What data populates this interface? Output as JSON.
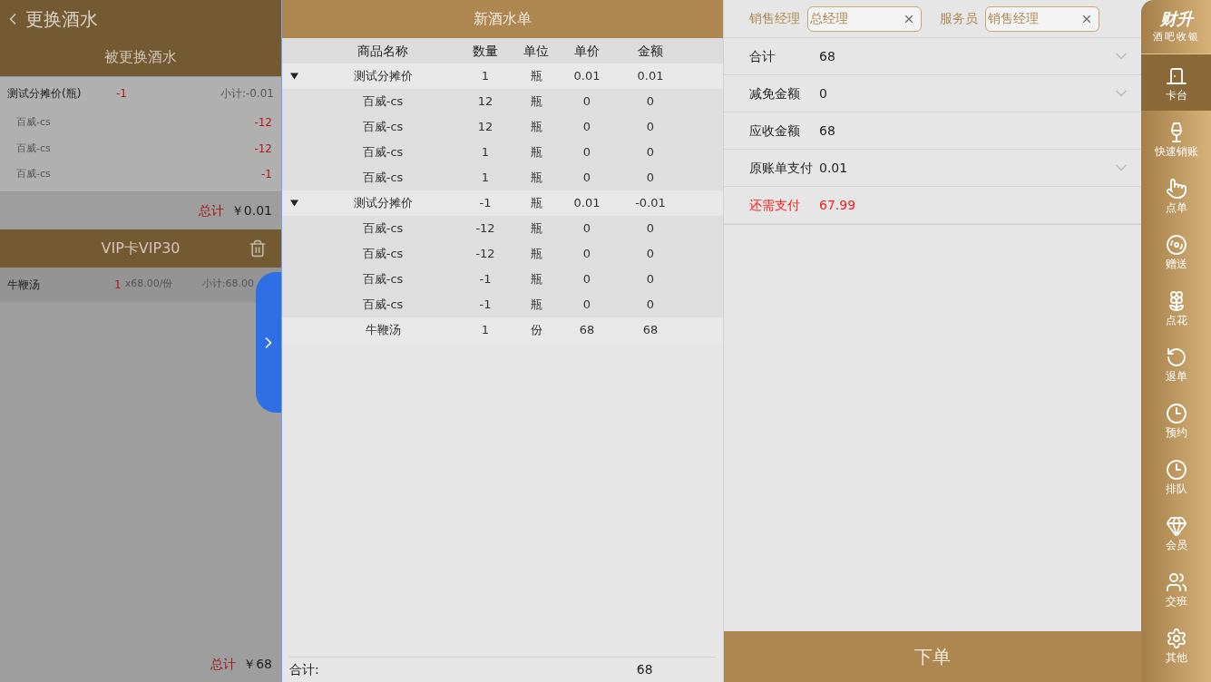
{
  "left_panel": {
    "back_title": "更换酒水",
    "replaced_header": "被更换酒水",
    "replaced_item": {
      "name": "测试分摊价(瓶)",
      "qty": "-1",
      "subtotal": "小计:-0.01",
      "children": [
        {
          "name": "百威-cs",
          "qty": "-12"
        },
        {
          "name": "百威-cs",
          "qty": "-12"
        },
        {
          "name": "百威-cs",
          "qty": "-1"
        }
      ]
    },
    "replaced_total": {
      "label": "总计",
      "value": "￥0.01"
    },
    "card_header": "VIP卡VIP30",
    "card_items": [
      {
        "name": "牛鞭汤",
        "qty": "1",
        "price": "x68.00/份",
        "subtotal": "小计:68.00"
      }
    ],
    "card_total": {
      "label": "总计",
      "value": "￥68"
    }
  },
  "new_order": {
    "title": "新酒水单",
    "columns": [
      "商品名称",
      "数量",
      "单位",
      "单价",
      "金额"
    ],
    "rows": [
      {
        "cells": [
          "测试分摊价",
          "1",
          "瓶",
          "0.01",
          "0.01"
        ],
        "expanded": true,
        "children": [
          {
            "cells": [
              "百威-cs",
              "12",
              "瓶",
              "0",
              "0"
            ]
          },
          {
            "cells": [
              "百威-cs",
              "12",
              "瓶",
              "0",
              "0"
            ]
          },
          {
            "cells": [
              "百威-cs",
              "1",
              "瓶",
              "0",
              "0"
            ]
          },
          {
            "cells": [
              "百威-cs",
              "1",
              "瓶",
              "0",
              "0"
            ]
          }
        ]
      },
      {
        "cells": [
          "测试分摊价",
          "-1",
          "瓶",
          "0.01",
          "-0.01"
        ],
        "expanded": true,
        "children": [
          {
            "cells": [
              "百威-cs",
              "-12",
              "瓶",
              "0",
              "0"
            ]
          },
          {
            "cells": [
              "百威-cs",
              "-12",
              "瓶",
              "0",
              "0"
            ]
          },
          {
            "cells": [
              "百威-cs",
              "-1",
              "瓶",
              "0",
              "0"
            ]
          },
          {
            "cells": [
              "百威-cs",
              "-1",
              "瓶",
              "0",
              "0"
            ]
          }
        ]
      },
      {
        "cells": [
          "牛鞭汤",
          "1",
          "份",
          "68",
          "68"
        ]
      }
    ],
    "footer": {
      "label": "合计:",
      "value": "68"
    }
  },
  "payment": {
    "staff": [
      {
        "label": "销售经理",
        "value": "总经理"
      },
      {
        "label": "服务员",
        "value": "销售经理"
      }
    ],
    "rows": [
      {
        "label": "合计",
        "value": "68",
        "expandable": true,
        "highlight": false
      },
      {
        "label": "减免金额",
        "value": "0",
        "expandable": true,
        "highlight": false
      },
      {
        "label": "应收金额",
        "value": "68",
        "expandable": false,
        "highlight": false
      },
      {
        "label": "原账单支付",
        "value": "0.01",
        "expandable": true,
        "highlight": false
      },
      {
        "label": "还需支付",
        "value": "67.99",
        "expandable": false,
        "highlight": true
      }
    ],
    "submit": "下单"
  },
  "sidebar": {
    "logo": "财升",
    "subtitle": "酒吧收银",
    "items": [
      {
        "kind": "door",
        "label": "卡台",
        "selected": true
      },
      {
        "kind": "bottle",
        "label": "快速销账",
        "selected": false
      },
      {
        "kind": "hand",
        "label": "点单",
        "selected": false
      },
      {
        "kind": "gift",
        "label": "赠送",
        "selected": false
      },
      {
        "kind": "flower",
        "label": "点花",
        "selected": false
      },
      {
        "kind": "refund",
        "label": "退单",
        "selected": false
      },
      {
        "kind": "clock",
        "label": "预约",
        "selected": false
      },
      {
        "kind": "clock",
        "label": "排队",
        "selected": false
      },
      {
        "kind": "gem",
        "label": "会员",
        "selected": false
      },
      {
        "kind": "users",
        "label": "交班",
        "selected": false
      },
      {
        "kind": "settings",
        "label": "其他",
        "selected": false
      }
    ]
  }
}
